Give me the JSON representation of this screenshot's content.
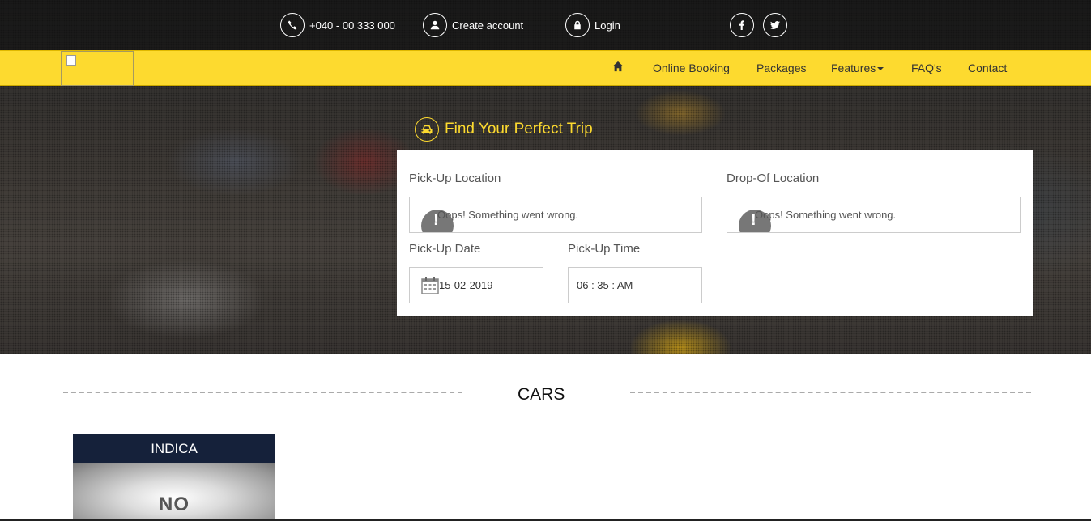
{
  "topbar": {
    "phone": "+040 - 00 333 000",
    "create_account": "Create account",
    "login": "Login"
  },
  "nav": {
    "items": [
      "Online Booking",
      "Packages",
      "Features",
      "FAQ's",
      "Contact"
    ]
  },
  "booking": {
    "title": "Find Your Perfect Trip",
    "pickup_location_label": "Pick-Up Location",
    "dropoff_location_label": "Drop-Of Location",
    "map_error": "Oops! Something went wrong.",
    "pickup_date_label": "Pick-Up Date",
    "pickup_date_value": "15-02-2019",
    "pickup_time_label": "Pick-Up Time",
    "pickup_time_value": "06 : 35 : AM"
  },
  "cars": {
    "section_title": "CARS",
    "items": [
      {
        "name": "INDICA",
        "image_text": "NO"
      }
    ]
  },
  "colors": {
    "accent": "#fdda2f",
    "card_header": "#15213a"
  }
}
